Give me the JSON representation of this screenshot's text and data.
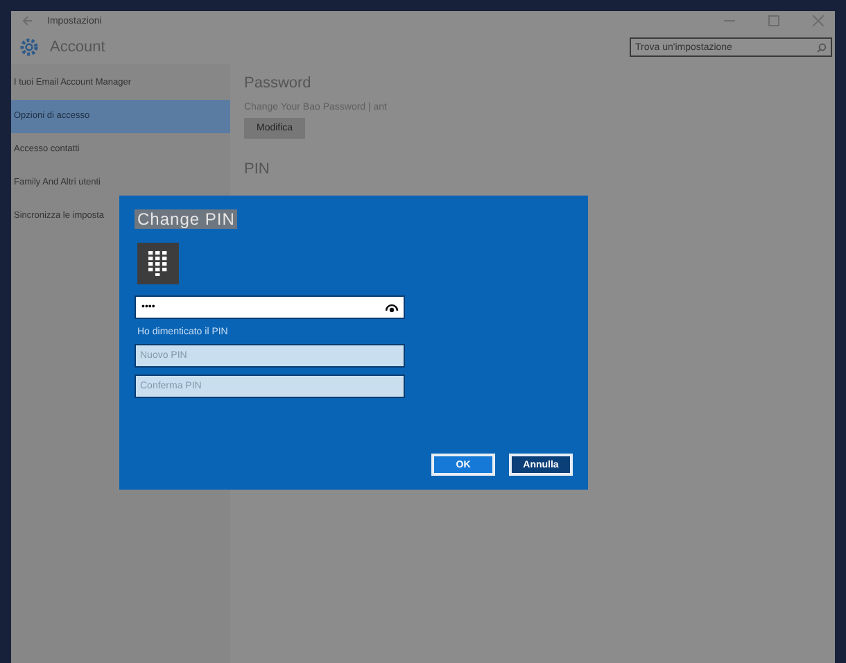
{
  "window": {
    "title": "Impostazioni"
  },
  "header": {
    "title": "Account",
    "search": {
      "placeholder": "Trova un'impostazione"
    }
  },
  "sidebar": {
    "items": [
      {
        "label": "I tuoi Email Account Manager",
        "selected": false
      },
      {
        "label": "Opzioni di accesso",
        "selected": true
      },
      {
        "label": "Accesso contatti",
        "selected": false
      },
      {
        "label": "Family And Altri utenti",
        "selected": false
      },
      {
        "label": "Sincronizza le imposta",
        "selected": false
      }
    ]
  },
  "main": {
    "password": {
      "heading": "Password",
      "text": "Change Your Bao Password | ant",
      "button": "Modifica"
    },
    "pin": {
      "heading": "PIN"
    }
  },
  "dialog": {
    "title": "Change PIN",
    "pin_field": {
      "value": "••••"
    },
    "link": "Ho dimenticato il PIN",
    "fields": [
      {
        "placeholder": "Nuovo PIN"
      },
      {
        "placeholder": "Conferma PIN"
      }
    ],
    "buttons": [
      {
        "label": "OK",
        "selected": true
      },
      {
        "label": "Annulla",
        "selected": false
      }
    ]
  }
}
